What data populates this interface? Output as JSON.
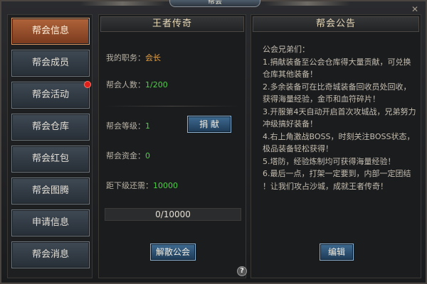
{
  "window": {
    "title": "帮会",
    "close_icon": "close-icon"
  },
  "sidebar": {
    "items": [
      {
        "label": "帮会信息",
        "active": true
      },
      {
        "label": "帮会成员"
      },
      {
        "label": "帮会活动",
        "badge": true
      },
      {
        "label": "帮会仓库"
      },
      {
        "label": "帮会红包"
      },
      {
        "label": "帮会图腾"
      },
      {
        "label": "申请信息"
      },
      {
        "label": "帮会消息"
      }
    ]
  },
  "info": {
    "title": "王者传奇",
    "duty_label": "我的职务：",
    "duty_value": "会长",
    "members_label": "帮会人数：",
    "members_value": "1/200",
    "level_label": "帮会等级：",
    "level_value": "1",
    "donate_button": "捐 献",
    "funds_label": "帮会资金：",
    "funds_value": "0",
    "next_label": "距下级还需：",
    "next_value": "10000",
    "progress_text": "0/10000",
    "progress_fraction": 0,
    "disband_button": "解散公会",
    "help_icon": "?"
  },
  "notice": {
    "title": "帮会公告",
    "lines": [
      "公会兄弟们：",
      "1.捐献装备至公会仓库得大量贡献，可兑换",
      "仓库其他装备！",
      "2.多余装备可在比奇城装备回收员处回收，",
      "获得海量经验，金币和血符碎片！",
      "3.开服第4天自动开启首次攻城战，兄弟努力",
      "冲级搞好装备！",
      "4.右上角激战BOSS，时刻关注BOSS状态，",
      "极品装备轻松获得！",
      "5.塔防，经验炼制均可获得海量经验！",
      "6.最后一点，打架一定要到，内部一定团结",
      "！让我们攻占沙城，成就王者传奇！"
    ],
    "edit_button": "编辑"
  }
}
